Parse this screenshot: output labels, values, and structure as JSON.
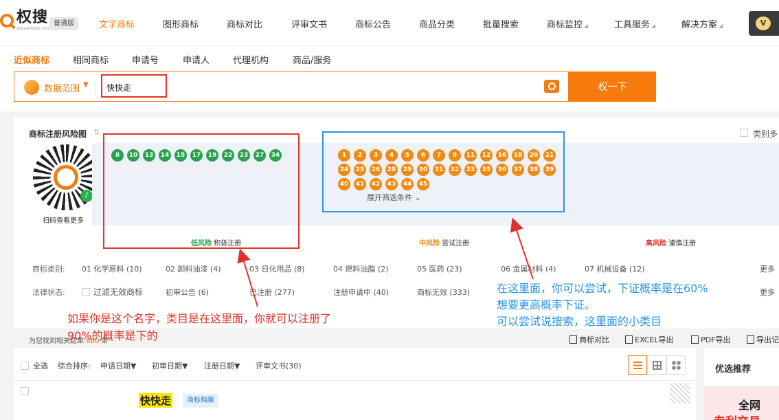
{
  "brand": {
    "name": "权搜",
    "domain": "soquanbiao.com",
    "edition": "普通版"
  },
  "nav": [
    {
      "label": "文字商标",
      "active": true
    },
    {
      "label": "图形商标"
    },
    {
      "label": "商标对比"
    },
    {
      "label": "评审文书"
    },
    {
      "label": "商标公告"
    },
    {
      "label": "商品分类"
    },
    {
      "label": "批量搜索"
    },
    {
      "label": "商标监控"
    },
    {
      "label": "工具服务"
    },
    {
      "label": "解决方案"
    }
  ],
  "vip_badge": "V",
  "subtabs": [
    "近似商标",
    "相同商标",
    "申请号",
    "申请人",
    "代理机构",
    "商品/服务"
  ],
  "search": {
    "scope_label": "数据范围",
    "query": "快快走",
    "button": "权一下"
  },
  "risk": {
    "title": "商标注册风险图",
    "qr_label": "扫码查看更多",
    "low_label": "低风险",
    "low_action": "积极注册",
    "mid_label": "中风险",
    "mid_action": "尝试注册",
    "high_label": "高风险",
    "high_action": "谨慎注册",
    "low_classes": [
      "8",
      "10",
      "13",
      "14",
      "15",
      "17",
      "19",
      "22",
      "23",
      "27",
      "34"
    ],
    "mid_classes": [
      "1",
      "2",
      "3",
      "4",
      "5",
      "6",
      "7",
      "9",
      "11",
      "12",
      "16",
      "18",
      "20",
      "21",
      "24",
      "25",
      "26",
      "28",
      "29",
      "30",
      "31",
      "32",
      "33",
      "35",
      "36",
      "37",
      "38",
      "39",
      "40",
      "41",
      "42",
      "43",
      "44",
      "45"
    ],
    "category_checkbox": "类别多"
  },
  "filters": {
    "category_key": "商标类别:",
    "categories": [
      "01 化学原料 (10)",
      "02 颜料油漆 (4)",
      "03 日化用品 (8)",
      "04 燃料油脂 (2)",
      "05 医药 (23)",
      "06 金属材料 (4)",
      "07 机械设备 (12)"
    ],
    "status_key": "法律状态:",
    "filter_invalid": "过滤无效商标",
    "statuses": [
      "初审公告 (6)",
      "已注册 (277)",
      "注册申请中 (40)",
      "商标无效 (333)"
    ],
    "more": "更多",
    "expand": "展开筛选条件"
  },
  "annotations": {
    "red_line1": "如果你是这个名字，类目是在这里面，你就可以注册了",
    "red_line2": "90%的概率是下的",
    "blue_line1": "在这里面，你可以尝试，下证概率是在60%",
    "blue_line2": "想要更高概率下证。",
    "blue_line3": "可以尝试说搜索，这里面的小类目"
  },
  "results": {
    "info_prefix": "为您找到相关结果",
    "count": "660",
    "info_suffix": "条",
    "exports": [
      "商标对比",
      "EXCEL导出",
      "PDF导出",
      "导出记"
    ]
  },
  "list": {
    "select_all": "全选",
    "sort_label": "综合排序:",
    "sorts": [
      "申请日期",
      "初审日期",
      "注册日期"
    ],
    "review_docs": "评审文书(30)",
    "first_mark": "快快走",
    "first_mark_tag": "商标档案"
  },
  "recommend": {
    "title": "优选推荐",
    "banner_title": "全网",
    "banner_sub": "专利交易"
  },
  "colors": {
    "accent": "#f07c12",
    "low": "#2aa24b",
    "mid": "#f08a10",
    "annotation_red": "#e0322a",
    "annotation_blue": "#2b95e6"
  }
}
